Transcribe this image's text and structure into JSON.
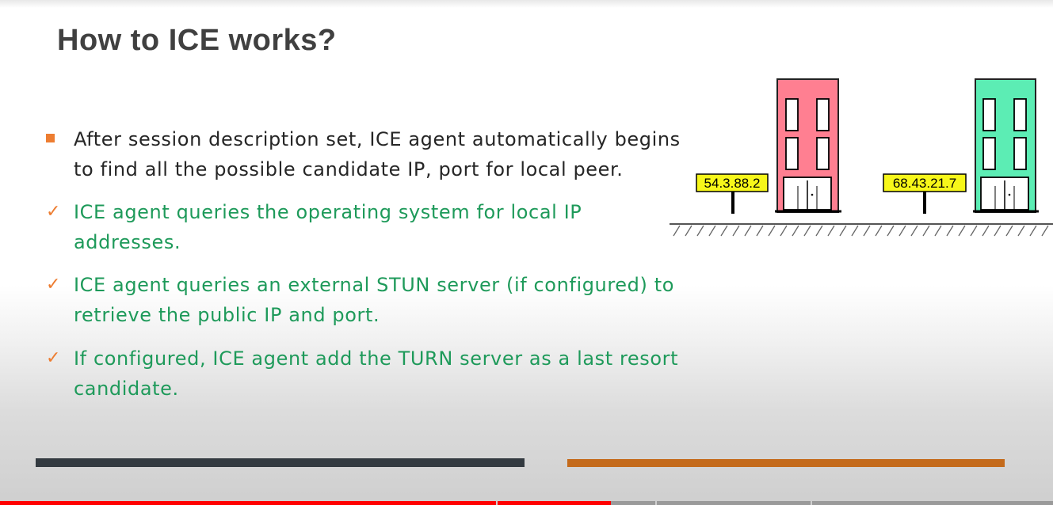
{
  "slide": {
    "title": "How to ICE works?",
    "bullets": [
      {
        "marker": "square",
        "style": "black",
        "lines": [
          "After session description set, ICE agent automatically begins",
          "to find all the possible candidate IP, port for local peer."
        ]
      },
      {
        "marker": "check",
        "style": "green",
        "lines": [
          "ICE agent queries the operating system for local IP",
          "addresses."
        ]
      },
      {
        "marker": "check",
        "style": "green",
        "lines": [
          "ICE agent queries an external STUN server (if configured) to",
          "retrieve the public IP and port."
        ]
      },
      {
        "marker": "check",
        "style": "green",
        "lines": [
          "If configured, ICE agent add the TURN server as a last resort",
          "candidate."
        ]
      }
    ],
    "check_glyph": "✓",
    "illustration": {
      "left_building": {
        "ip": "54.3.88.2",
        "color": "#ff7f91"
      },
      "right_building": {
        "ip": "68.43.21.7",
        "color": "#5cedb4"
      }
    },
    "colors": {
      "accent": "#ed7d31",
      "green_text": "#1e9a5a",
      "label_bg": "#f7f71a",
      "dark_bar": "#333a40",
      "orange_bar": "#c46a1b"
    }
  },
  "player": {
    "progress_fraction": 0.58
  }
}
